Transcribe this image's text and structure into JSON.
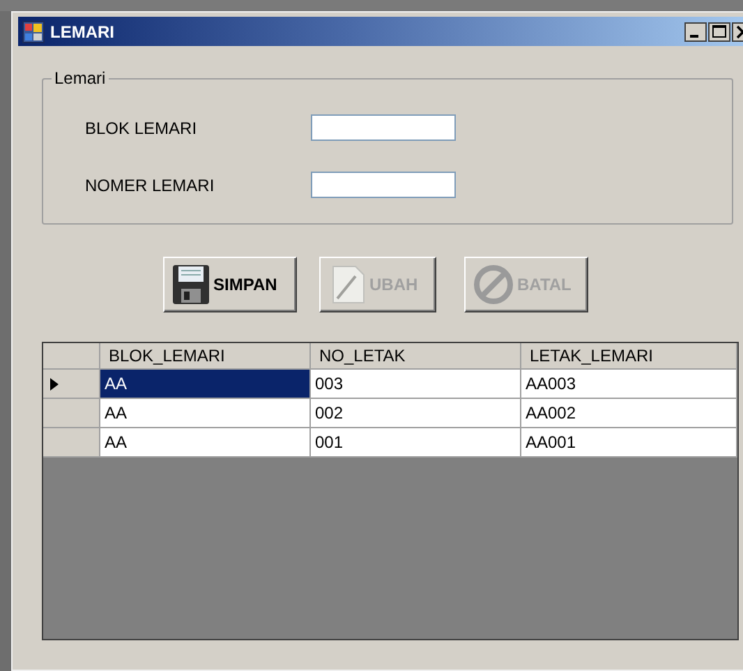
{
  "window": {
    "title": "LEMARI"
  },
  "group": {
    "title": "Lemari",
    "fields": [
      {
        "label": "BLOK LEMARI"
      },
      {
        "label": "NOMER LEMARI"
      }
    ]
  },
  "buttons": [
    {
      "label": "SIMPAN",
      "kind": "save",
      "disabled": false
    },
    {
      "label": "UBAH",
      "kind": "edit",
      "disabled": true
    },
    {
      "label": "BATAL",
      "kind": "cancel",
      "disabled": true
    }
  ],
  "table": {
    "columns": [
      "BLOK_LEMARI",
      "NO_LETAK",
      "LETAK_LEMARI"
    ],
    "rows": [
      {
        "cells": [
          "AA",
          "003",
          "AA003"
        ],
        "selected": true
      },
      {
        "cells": [
          "AA",
          "002",
          "AA002"
        ],
        "selected": false
      },
      {
        "cells": [
          "AA",
          "001",
          "AA001"
        ],
        "selected": false
      }
    ]
  }
}
